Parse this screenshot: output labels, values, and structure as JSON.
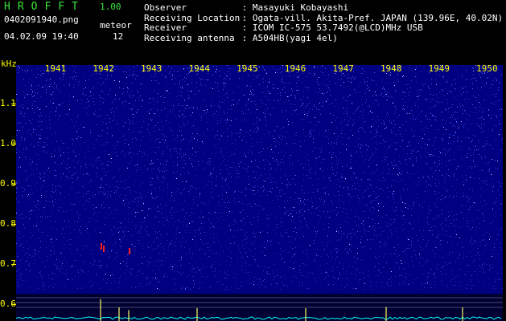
{
  "header": {
    "app_name": "HROFFT",
    "version": "1.00",
    "filename": "0402091940.png",
    "datetime": "04.02.09 19:40",
    "meteor_label": "meteor",
    "meteor_count": "12"
  },
  "info": [
    {
      "label": "Observer",
      "value": "Masayuki Kobayashi"
    },
    {
      "label": "Receiving Location",
      "value": "Ogata-vill. Akita-Pref. JAPAN (139.96E, 40.02N)"
    },
    {
      "label": "Receiver",
      "value": "ICOM IC-575 53.7492(@LCD)MHz USB"
    },
    {
      "label": "Receiving antenna",
      "value": "A504HB(yagi 4el)"
    }
  ],
  "spectrogram": {
    "y_unit": "kHz",
    "time_labels": [
      "1941",
      "1942",
      "1943",
      "1944",
      "1945",
      "1946",
      "1947",
      "1948",
      "1949",
      "1950"
    ],
    "freq_labels": [
      "1.1",
      "1.0",
      "0.9",
      "0.8",
      "0.7",
      "0.6"
    ],
    "colors": {
      "background": "#000080",
      "signal": "#4060ff",
      "label": "#ffff00",
      "hot": "#ff2020",
      "trace": "#00ffff"
    }
  }
}
